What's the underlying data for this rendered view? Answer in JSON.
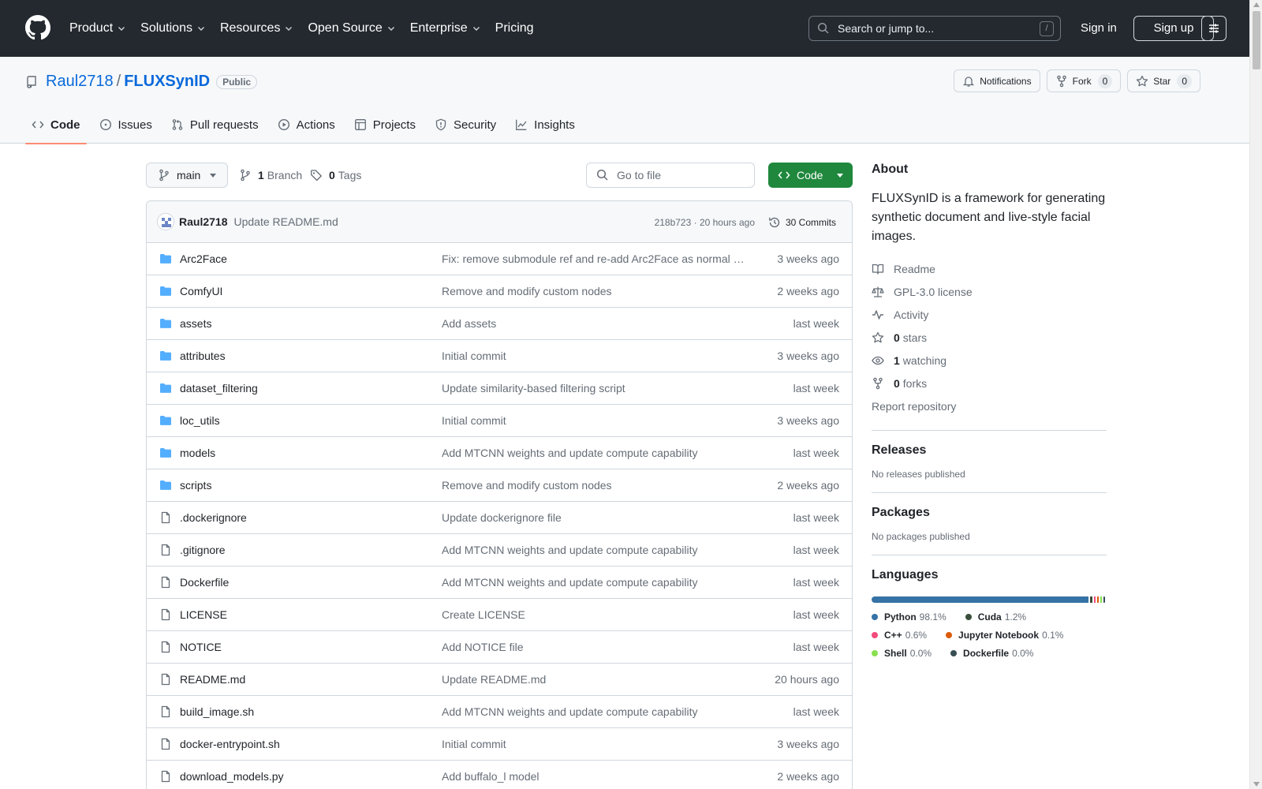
{
  "header": {
    "nav": [
      "Product",
      "Solutions",
      "Resources",
      "Open Source",
      "Enterprise",
      "Pricing"
    ],
    "search_placeholder": "Search or jump to...",
    "search_shortcut": "/",
    "signin": "Sign in",
    "signup": "Sign up"
  },
  "repo": {
    "owner": "Raul2718",
    "separator": "/",
    "name": "FLUXSynID",
    "visibility": "Public",
    "notifications_label": "Notifications",
    "fork_label": "Fork",
    "fork_count": "0",
    "star_label": "Star",
    "star_count": "0",
    "tabs": [
      "Code",
      "Issues",
      "Pull requests",
      "Actions",
      "Projects",
      "Security",
      "Insights"
    ]
  },
  "toolbar": {
    "branch": "main",
    "branch_count": "1",
    "branch_label": "Branch",
    "tag_count": "0",
    "tag_label": "Tags",
    "goto_placeholder": "Go to file",
    "code_button": "Code"
  },
  "last_commit": {
    "author": "Raul2718",
    "message": "Update README.md",
    "meta": "218b723 · 20 hours ago",
    "commits": "30 Commits"
  },
  "files": [
    {
      "type": "dir",
      "name": "Arc2Face",
      "message": "Fix: remove submodule ref and re-add Arc2Face as normal …",
      "date": "3 weeks ago"
    },
    {
      "type": "dir",
      "name": "ComfyUI",
      "message": "Remove and modify custom nodes",
      "date": "2 weeks ago"
    },
    {
      "type": "dir",
      "name": "assets",
      "message": "Add assets",
      "date": "last week"
    },
    {
      "type": "dir",
      "name": "attributes",
      "message": "Initial commit",
      "date": "3 weeks ago"
    },
    {
      "type": "dir",
      "name": "dataset_filtering",
      "message": "Update similarity-based filtering script",
      "date": "last week"
    },
    {
      "type": "dir",
      "name": "loc_utils",
      "message": "Initial commit",
      "date": "3 weeks ago"
    },
    {
      "type": "dir",
      "name": "models",
      "message": "Add MTCNN weights and update compute capability",
      "date": "last week"
    },
    {
      "type": "dir",
      "name": "scripts",
      "message": "Remove and modify custom nodes",
      "date": "2 weeks ago"
    },
    {
      "type": "file",
      "name": ".dockerignore",
      "message": "Update dockerignore file",
      "date": "last week"
    },
    {
      "type": "file",
      "name": ".gitignore",
      "message": "Add MTCNN weights and update compute capability",
      "date": "last week"
    },
    {
      "type": "file",
      "name": "Dockerfile",
      "message": "Add MTCNN weights and update compute capability",
      "date": "last week"
    },
    {
      "type": "file",
      "name": "LICENSE",
      "message": "Create LICENSE",
      "date": "last week"
    },
    {
      "type": "file",
      "name": "NOTICE",
      "message": "Add NOTICE file",
      "date": "last week"
    },
    {
      "type": "file",
      "name": "README.md",
      "message": "Update README.md",
      "date": "20 hours ago"
    },
    {
      "type": "file",
      "name": "build_image.sh",
      "message": "Add MTCNN weights and update compute capability",
      "date": "last week"
    },
    {
      "type": "file",
      "name": "docker-entrypoint.sh",
      "message": "Initial commit",
      "date": "3 weeks ago"
    },
    {
      "type": "file",
      "name": "download_models.py",
      "message": "Add buffalo_l model",
      "date": "2 weeks ago"
    },
    {
      "type": "file",
      "name": "",
      "message": "",
      "date": ""
    }
  ],
  "about": {
    "title": "About",
    "description": "FLUXSynID is a framework for generating synthetic document and live-style facial images.",
    "readme": "Readme",
    "license": "GPL-3.0 license",
    "activity": "Activity",
    "stars_count": "0",
    "stars_label": "stars",
    "watching_count": "1",
    "watching_label": "watching",
    "forks_count": "0",
    "forks_label": "forks",
    "report": "Report repository"
  },
  "releases": {
    "title": "Releases",
    "empty": "No releases published"
  },
  "packages": {
    "title": "Packages",
    "empty": "No packages published"
  },
  "languages": {
    "title": "Languages",
    "items": [
      {
        "name": "Python",
        "pct": "98.1%",
        "share": 98.1,
        "color": "#3572A5"
      },
      {
        "name": "Cuda",
        "pct": "1.2%",
        "share": 1.2,
        "color": "#3A4E3A"
      },
      {
        "name": "C++",
        "pct": "0.6%",
        "share": 0.6,
        "color": "#f34b7d"
      },
      {
        "name": "Jupyter Notebook",
        "pct": "0.1%",
        "share": 0.1,
        "color": "#DA5B0B"
      },
      {
        "name": "Shell",
        "pct": "0.0%",
        "share": 0.05,
        "color": "#89e051"
      },
      {
        "name": "Dockerfile",
        "pct": "0.0%",
        "share": 0.05,
        "color": "#384d54"
      }
    ]
  }
}
